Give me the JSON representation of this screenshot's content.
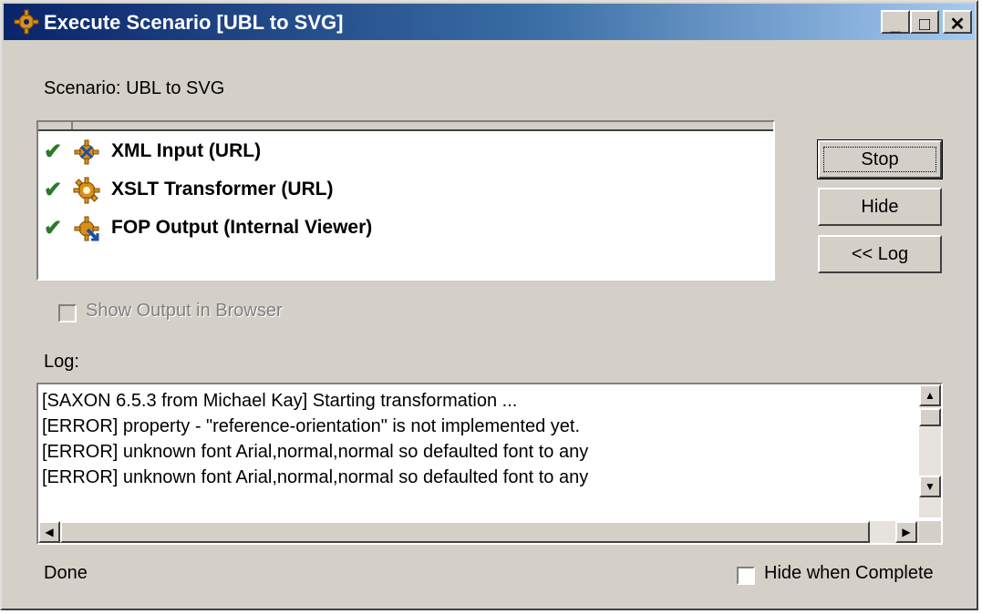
{
  "window": {
    "title": "Execute Scenario [UBL to SVG]",
    "minimize_label": "_",
    "maximize_label": "□",
    "close_label": "✕"
  },
  "scenario": {
    "label": "Scenario:",
    "value": "UBL to SVG"
  },
  "steps": [
    {
      "status": "✔",
      "icon": "xml-input-gear-icon",
      "name": "XML Input (URL)"
    },
    {
      "status": "✔",
      "icon": "xslt-transformer-gear-icon",
      "name": "XSLT Transformer (URL)"
    },
    {
      "status": "✔",
      "icon": "fop-output-gear-icon",
      "name": "FOP Output (Internal Viewer)"
    }
  ],
  "buttons": {
    "stop": "Stop",
    "hide": "Hide",
    "log": "<< Log"
  },
  "show_output": {
    "label": "Show Output in Browser",
    "checked": false,
    "enabled": false
  },
  "log": {
    "label": "Log:",
    "lines": [
      "[SAXON 6.5.3 from Michael Kay] Starting transformation ...",
      "[ERROR] property - \"reference-orientation\" is not implemented yet.",
      "[ERROR] unknown font Arial,normal,normal so defaulted font to any",
      "[ERROR] unknown font Arial,normal,normal so defaulted font to any"
    ]
  },
  "status": {
    "text": "Done"
  },
  "hide_when_complete": {
    "label": "Hide when Complete",
    "checked": false
  },
  "colors": {
    "title_gradient_start": "#0a246a",
    "title_gradient_end": "#a6caf0",
    "dialog_face": "#d4d0c8",
    "check_green": "#2a7a2a",
    "gear_orange": "#d9901a"
  }
}
